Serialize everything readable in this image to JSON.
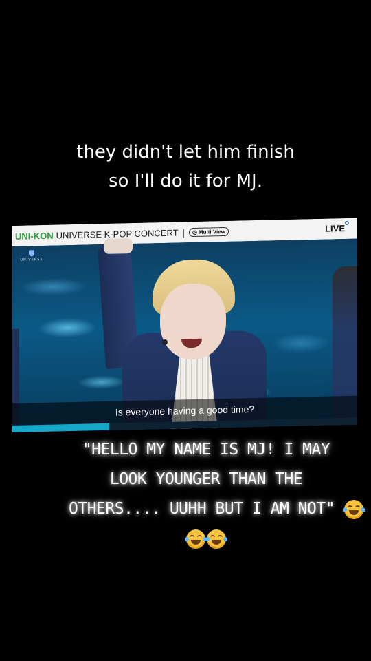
{
  "caption_top": {
    "line1": "they didn't let him finish",
    "line2": "so I'll do it for MJ."
  },
  "stream": {
    "brand": "UNI-KON",
    "title": "UNIVERSE K-POP CONCERT",
    "separator": "|",
    "multi_view_label": "Multi View",
    "live_label": "LIVE",
    "logo_label": "UNIVERSE",
    "subtitle": "Is everyone having a good time?",
    "progress_fraction": 0.28
  },
  "caption_bottom": {
    "line1": "\"HELLO MY NAME IS MJ! I MAY",
    "line2": "LOOK YOUNGER THAN THE",
    "line3": "OTHERS.... UUHH BUT I AM NOT\"",
    "emoji": "face-with-tears-of-joy"
  },
  "colors": {
    "background": "#000000",
    "brand_green": "#2a9d3a",
    "progress": "#15a8c9"
  }
}
